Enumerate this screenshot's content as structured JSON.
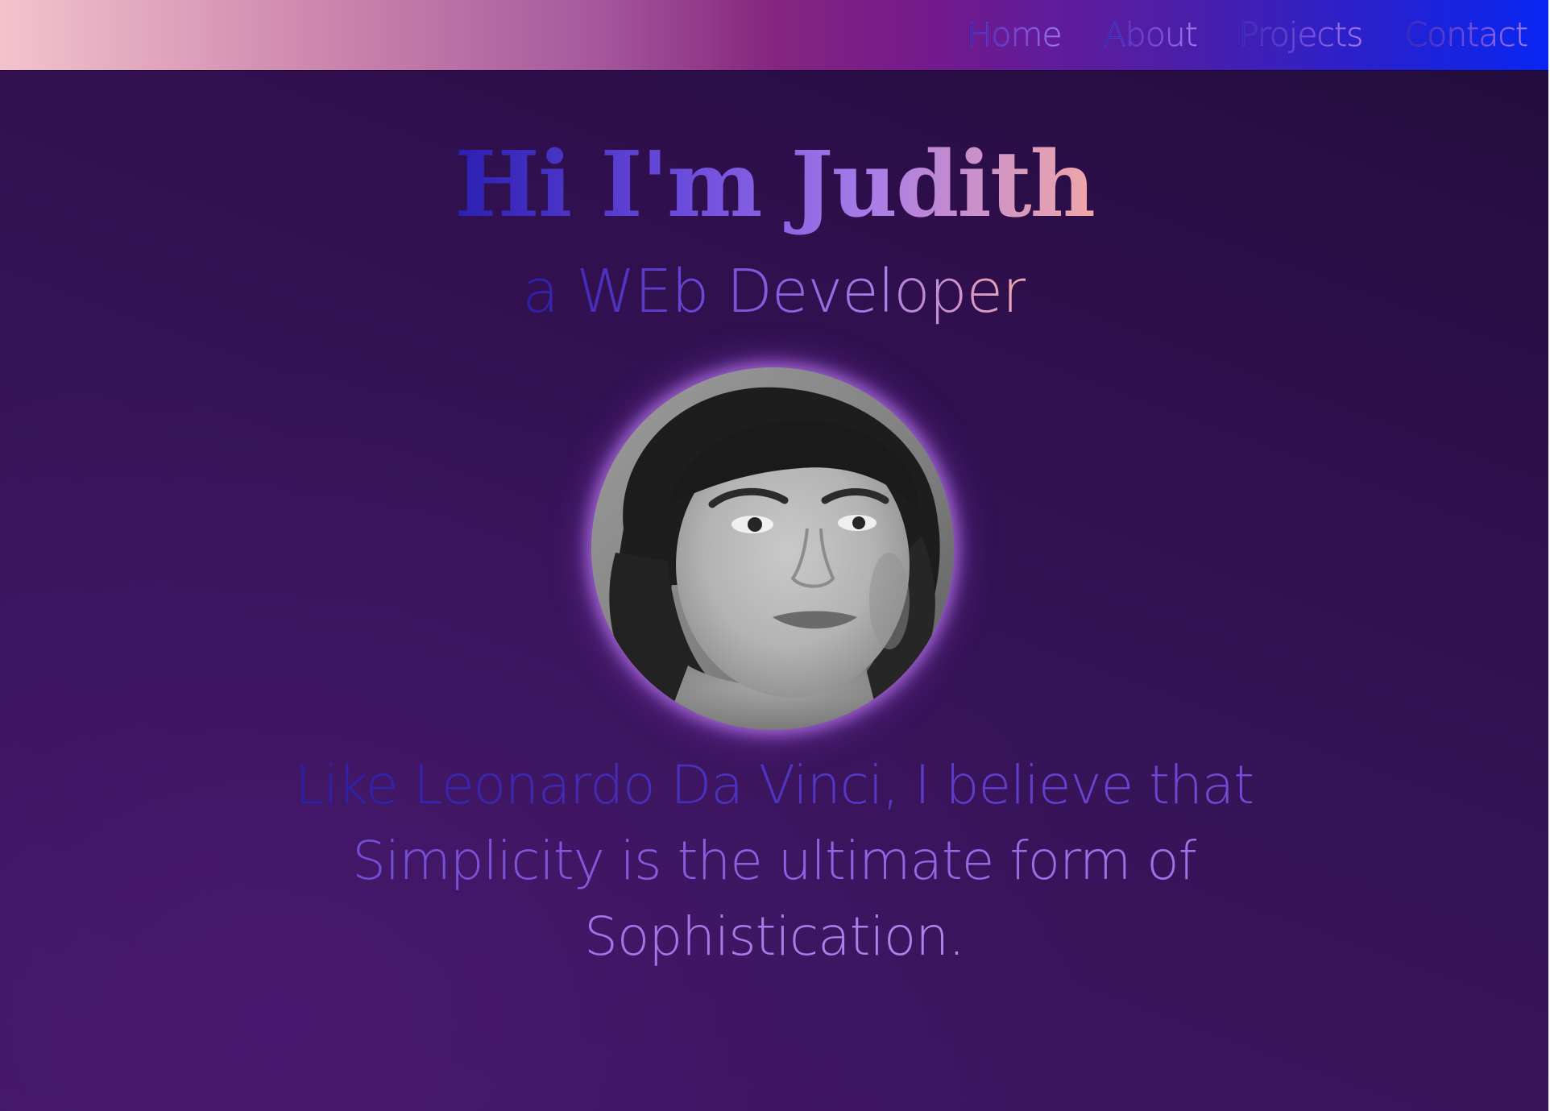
{
  "nav": {
    "items": [
      {
        "label": "Home"
      },
      {
        "label": "About"
      },
      {
        "label": "Projects"
      },
      {
        "label": "Contact"
      }
    ]
  },
  "hero": {
    "title": "Hi I'm Judith",
    "subtitle": "a WEb Developer",
    "avatar_icon": "profile-photo"
  },
  "quote": {
    "text": "Like Leonardo Da Vinci, I believe that Simplicity is the ultimate form of Sophistication."
  },
  "colors": {
    "background": "#2f0f4d",
    "nav_gradient_start": "#f3c3cd",
    "nav_gradient_mid": "#85257f",
    "nav_gradient_end": "#0826f2",
    "text_blue": "#2a1fb0",
    "text_violet": "#a77ce6",
    "text_peach": "#f0a7a7",
    "avatar_glow": "#b978eb"
  }
}
